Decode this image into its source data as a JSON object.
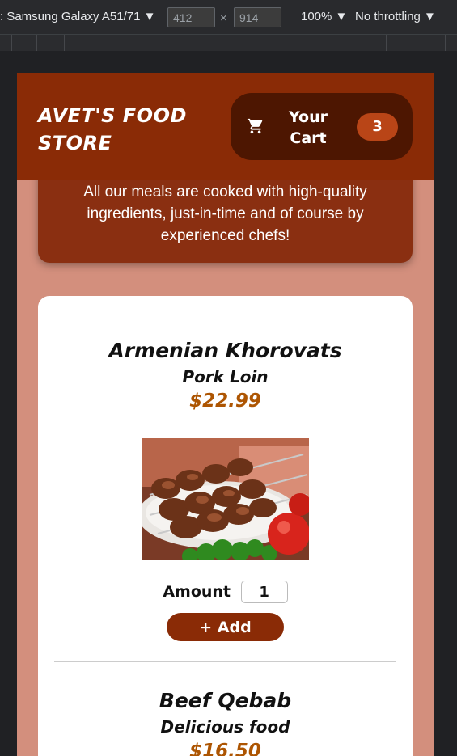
{
  "devtools": {
    "device": ": Samsung Galaxy A51/71 ▼",
    "width": "412",
    "times": "×",
    "height": "914",
    "zoom": "100% ▼",
    "throttling": "No throttling ▼"
  },
  "header": {
    "logo": "AVET'S FOOD STORE",
    "cart_label": "Your Cart",
    "cart_count": "3"
  },
  "summary": {
    "text": "All our meals are cooked with high-quality ingredients, just-in-time and of course by experienced chefs!"
  },
  "meals": [
    {
      "name": "Armenian Khorovats",
      "description": "Pork Loin",
      "price": "$22.99",
      "amount_label": "Amount",
      "amount_value": "1",
      "add_label": "+ Add"
    },
    {
      "name": "Beef Qebab",
      "description": "Delicious food",
      "price": "$16.50"
    }
  ],
  "colors": {
    "header": "#8a2b06",
    "cart_button": "#4d1601",
    "badge": "#b94517",
    "page_bg": "#d38f7d",
    "price": "#ad5502"
  }
}
